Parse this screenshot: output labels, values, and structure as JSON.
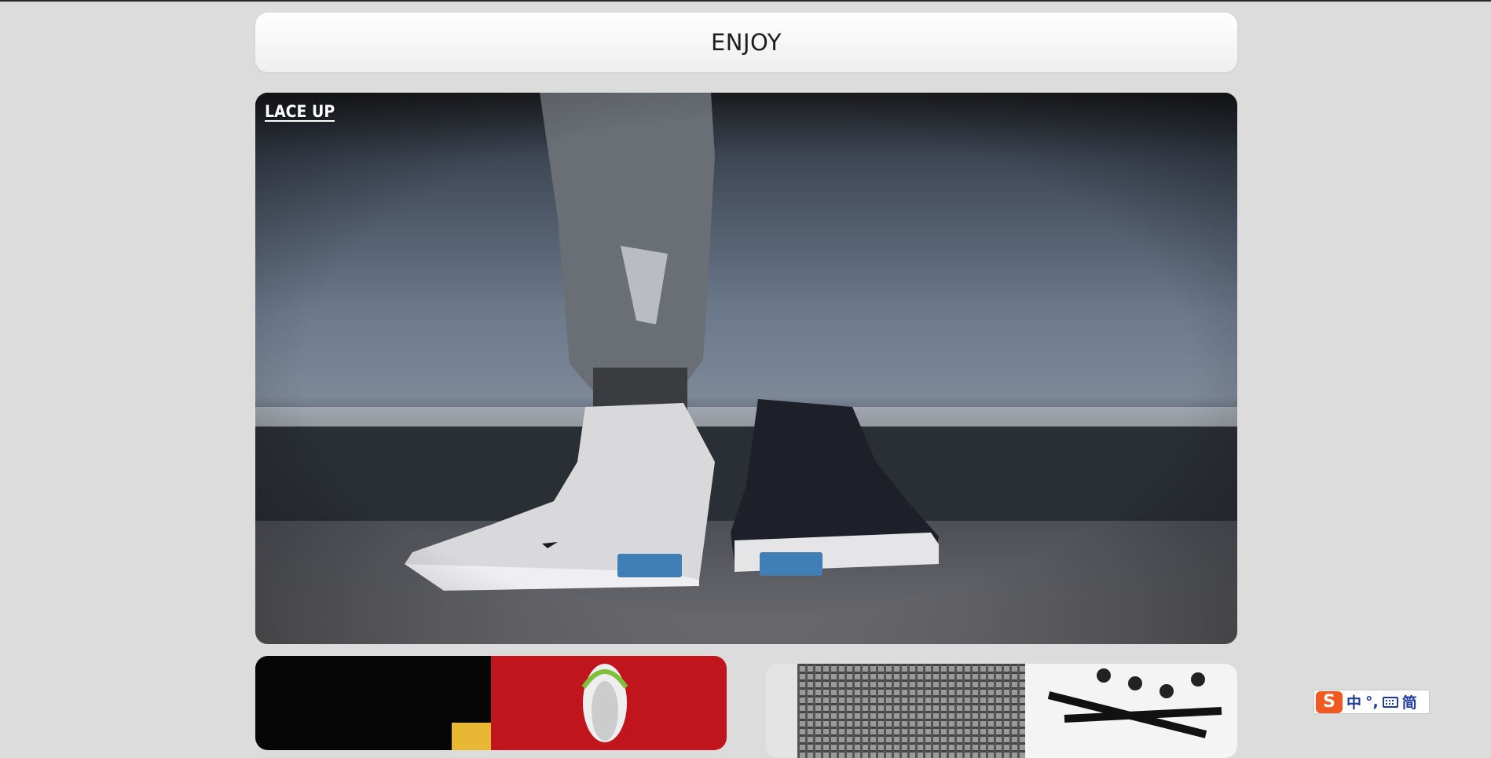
{
  "header": {
    "title": "ENJOY"
  },
  "hero": {
    "logo_text": "LACE UP"
  },
  "ime": {
    "logo": "S",
    "lang": "中",
    "punct": "°,",
    "keyboard_icon": "keyboard-icon",
    "mode": "简"
  }
}
